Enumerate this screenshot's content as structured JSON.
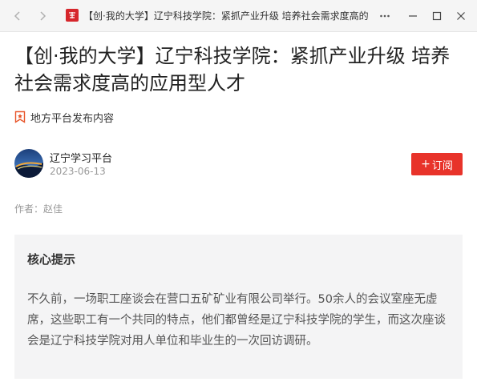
{
  "window": {
    "title": "【创·我的大学】辽宁科技学院：紧抓产业升级 培养社会需求度高的",
    "controls": [
      "more-icon",
      "minimize-icon",
      "maximize-icon",
      "close-icon"
    ],
    "accent": "#d6262b"
  },
  "article": {
    "headline": "【创·我的大学】辽宁科技学院：紧抓产业升级 培养社会需求度高的应用型人才",
    "source_tag": "地方平台发布内容",
    "author": {
      "name": "辽宁学习平台",
      "date": "2023-06-13"
    },
    "subscribe_label": "订阅",
    "subscribe_color": "#e8332a",
    "byline": "作者：赵佳",
    "summary": {
      "title": "核心提示",
      "text": "不久前，一场职工座谈会在营口五矿矿业有限公司举行。50余人的会议室座无虚席，这些职工有一个共同的特点，他们都曾经是辽宁科技学院的学生，而这次座谈会是辽宁科技学院对用人单位和毕业生的一次回访调研。"
    }
  }
}
